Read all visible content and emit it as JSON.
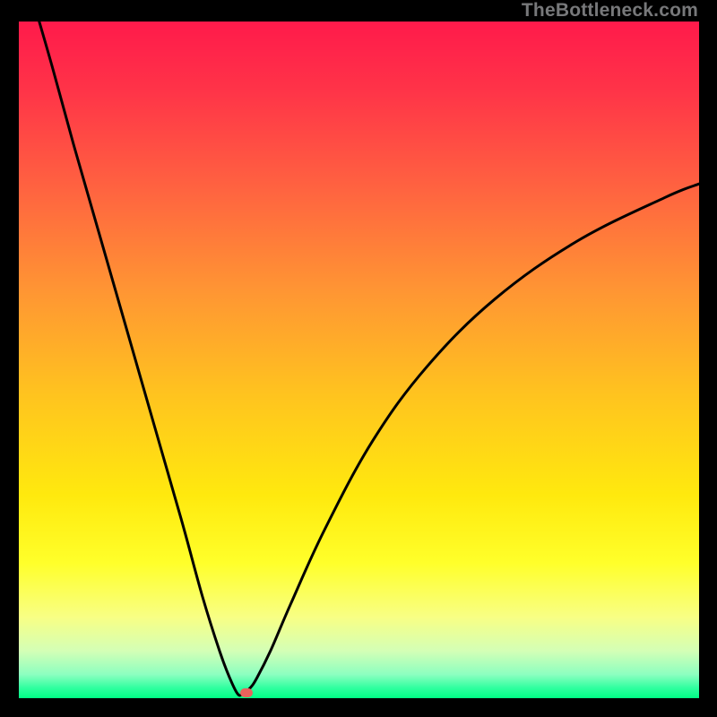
{
  "watermark": "TheBottleneck.com",
  "colors": {
    "black": "#000000",
    "curve": "#000000",
    "gradient_stops": [
      {
        "offset": 0.0,
        "color": "#ff1a4b"
      },
      {
        "offset": 0.1,
        "color": "#ff3348"
      },
      {
        "offset": 0.25,
        "color": "#ff6440"
      },
      {
        "offset": 0.4,
        "color": "#ff9633"
      },
      {
        "offset": 0.55,
        "color": "#ffc31f"
      },
      {
        "offset": 0.7,
        "color": "#ffe90e"
      },
      {
        "offset": 0.8,
        "color": "#ffff2a"
      },
      {
        "offset": 0.88,
        "color": "#f8ff84"
      },
      {
        "offset": 0.93,
        "color": "#d4ffb6"
      },
      {
        "offset": 0.965,
        "color": "#8cffc0"
      },
      {
        "offset": 0.985,
        "color": "#2fff9f"
      },
      {
        "offset": 1.0,
        "color": "#00ff85"
      }
    ],
    "marker": "#e9635c"
  },
  "chart_data": {
    "type": "line",
    "title": "",
    "xlabel": "",
    "ylabel": "",
    "xlim": [
      0,
      100
    ],
    "ylim": [
      0,
      100
    ],
    "series": [
      {
        "name": "bottleneck-curve",
        "x": [
          3,
          5,
          8,
          12,
          16,
          20,
          24,
          27,
          29.5,
          31,
          32.2,
          33,
          34,
          35,
          37,
          40,
          45,
          52,
          60,
          70,
          82,
          95,
          100
        ],
        "y": [
          100,
          93,
          82,
          68,
          54,
          40,
          26,
          15,
          7,
          3,
          0.6,
          0.7,
          1.5,
          3,
          7,
          14,
          25,
          38,
          49,
          59,
          67.5,
          74,
          76
        ]
      }
    ],
    "marker": {
      "x": 33.4,
      "y": 0.8
    }
  }
}
